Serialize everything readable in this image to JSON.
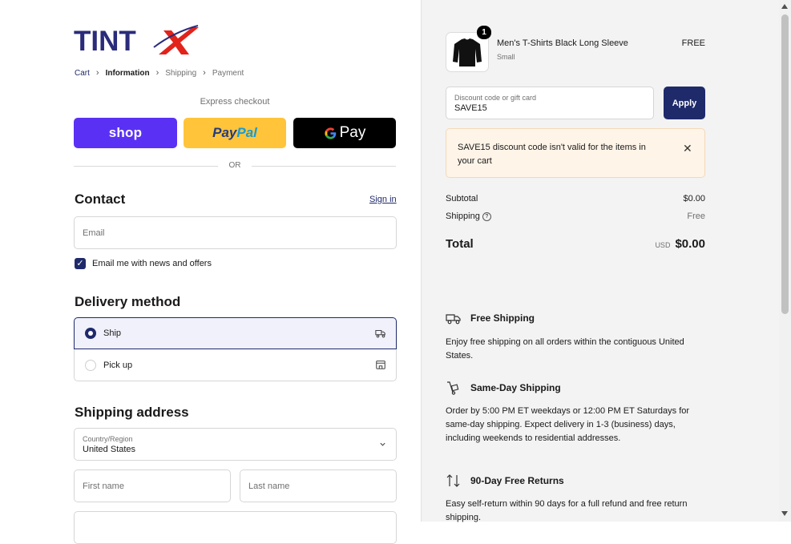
{
  "brand": {
    "logo_text": "TINT",
    "accent": "#e2231a",
    "primary": "#1f2a6b"
  },
  "breadcrumb": [
    "Cart",
    "Information",
    "Shipping",
    "Payment"
  ],
  "express": {
    "label": "Express checkout",
    "shop_label": "shop",
    "paypal_a": "Pay",
    "paypal_b": "Pal",
    "gpay_label": "Pay",
    "or": "OR"
  },
  "contact": {
    "title": "Contact",
    "sign_in": "Sign in",
    "email_placeholder": "Email",
    "newsletter_label": "Email me with news and offers",
    "newsletter_checked": true
  },
  "delivery": {
    "title": "Delivery method",
    "options": [
      {
        "label": "Ship",
        "selected": true,
        "icon": "truck-icon"
      },
      {
        "label": "Pick up",
        "selected": false,
        "icon": "store-icon"
      }
    ]
  },
  "shipping_address": {
    "title": "Shipping address",
    "country_label": "Country/Region",
    "country_value": "United States",
    "first_name_placeholder": "First name",
    "last_name_placeholder": "Last name"
  },
  "order": {
    "item": {
      "name": "Men's T-Shirts Black Long Sleeve",
      "variant": "Small",
      "price": "FREE",
      "quantity": "1"
    },
    "discount": {
      "label": "Discount code or gift card",
      "value": "SAVE15",
      "apply_label": "Apply",
      "error": "SAVE15 discount code isn't valid for the items in your cart"
    },
    "subtotal_label": "Subtotal",
    "subtotal_value": "$0.00",
    "shipping_label": "Shipping",
    "shipping_value": "Free",
    "total_label": "Total",
    "total_currency": "USD",
    "total_value": "$0.00"
  },
  "features": [
    {
      "title": "Free Shipping",
      "text": "Enjoy free shipping on all orders within the contiguous United States."
    },
    {
      "title": "Same-Day Shipping",
      "text": "Order by 5:00 PM ET weekdays or 12:00 PM ET Saturdays for same-day shipping. Expect delivery in 1-3 (business) days, including weekends to residential addresses."
    },
    {
      "title": "90-Day Free Returns",
      "text": "Easy self-return within 90 days for a full refund and free return shipping."
    }
  ]
}
